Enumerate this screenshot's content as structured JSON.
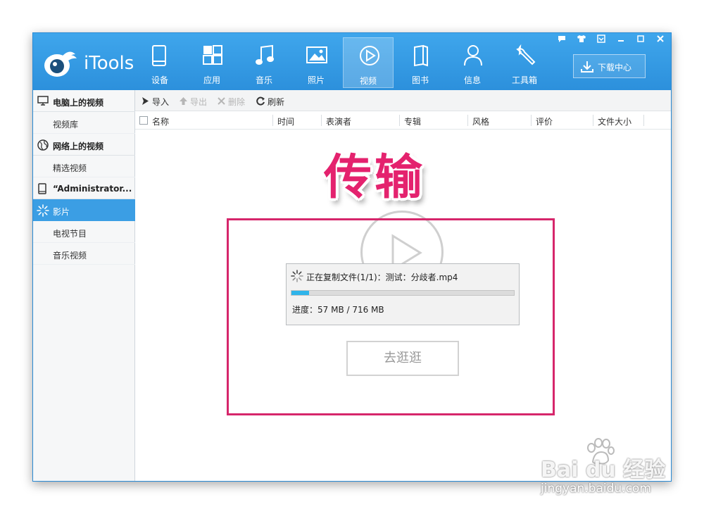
{
  "app": {
    "name": "iTools"
  },
  "nav": [
    {
      "id": "devices",
      "label": "设备",
      "icon": "phone-icon"
    },
    {
      "id": "apps",
      "label": "应用",
      "icon": "grid-icon"
    },
    {
      "id": "music",
      "label": "音乐",
      "icon": "music-note-icon"
    },
    {
      "id": "photos",
      "label": "照片",
      "icon": "image-icon"
    },
    {
      "id": "video",
      "label": "视频",
      "icon": "play-circle-icon",
      "active": true
    },
    {
      "id": "books",
      "label": "图书",
      "icon": "book-icon"
    },
    {
      "id": "info",
      "label": "信息",
      "icon": "person-icon"
    },
    {
      "id": "toolbox",
      "label": "工具箱",
      "icon": "wrench-icon"
    }
  ],
  "download_center": {
    "label": "下载中心",
    "icon": "download-icon"
  },
  "window_controls": [
    "message-icon",
    "skin-icon",
    "menu-icon",
    "minimize-icon",
    "maximize-icon",
    "close-icon"
  ],
  "sidebar": {
    "sections": [
      {
        "title": "电脑上的视频",
        "icon": "monitor-icon",
        "items": [
          "视频库"
        ]
      },
      {
        "title": "网络上的视频",
        "icon": "globe-icon",
        "items": [
          "精选视频"
        ]
      },
      {
        "title": "“Administrator...",
        "icon": "device-icon",
        "items": [
          "影片",
          "电视节目",
          "音乐视频"
        ]
      }
    ],
    "selected": "影片"
  },
  "toolbar": {
    "import": "导入",
    "export": "导出",
    "delete": "删除",
    "refresh": "刷新"
  },
  "columns": [
    "名称",
    "时间",
    "表演者",
    "专辑",
    "风格",
    "评价",
    "文件大小"
  ],
  "dialog": {
    "message": "正在复制文件(1/1)：测试：分歧者.mp4",
    "progress_label": "进度：57 MB / 716 MB",
    "progress_fraction": 0.0796
  },
  "go_button": "去逛逛",
  "annotation": "传输",
  "watermark": {
    "brand": "Bai du 经验",
    "url": "jingyan.baidu.com"
  },
  "colors": {
    "header": "#2c90dc",
    "selected": "#3b9ee4",
    "annotation": "#e4226e",
    "progress": "#2fb4ea"
  }
}
